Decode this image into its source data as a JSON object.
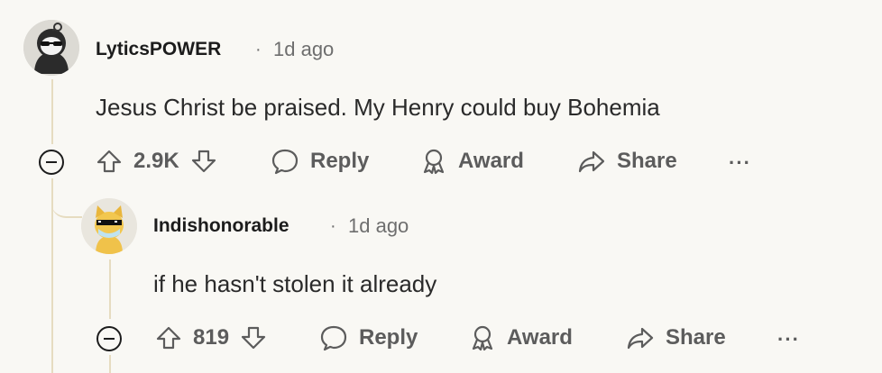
{
  "comments": [
    {
      "username": "LyticsPOWER",
      "separator": "·",
      "time": "1d ago",
      "body": "Jesus Christ be praised. My Henry could buy Bohemia",
      "score": "2.9K",
      "actions": {
        "reply": "Reply",
        "award": "Award",
        "share": "Share",
        "more": "···"
      },
      "avatar_icon": "snoo-sunglasses-avatar"
    },
    {
      "username": "Indishonorable",
      "separator": "·",
      "time": "1d ago",
      "body": "if he hasn't stolen it already",
      "score": "819",
      "actions": {
        "reply": "Reply",
        "award": "Award",
        "share": "Share",
        "more": "···"
      },
      "avatar_icon": "snoo-doge-avatar"
    }
  ],
  "colors": {
    "background": "#f9f8f4",
    "thread_line": "#e6dcc0",
    "text_muted": "#6e6e6e",
    "action_gray": "#5c5c5c"
  }
}
